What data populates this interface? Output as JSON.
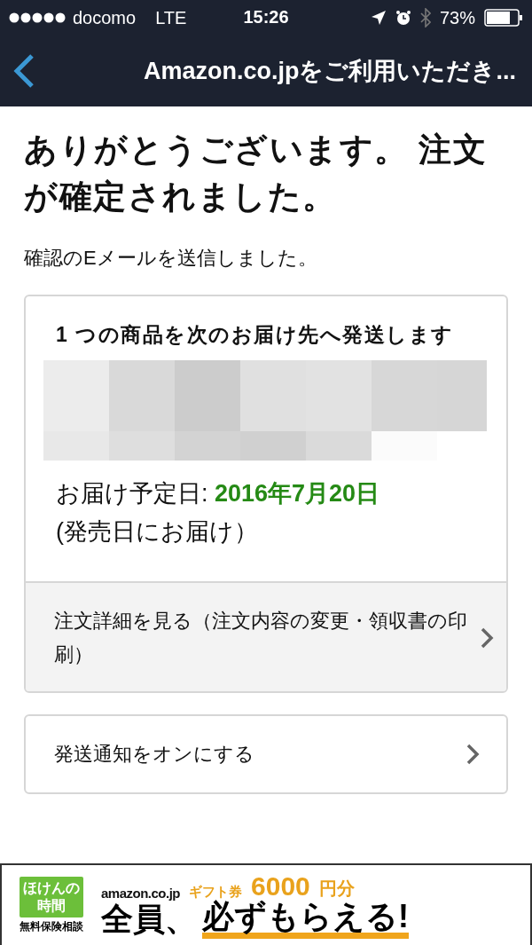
{
  "status_bar": {
    "carrier": "docomo",
    "network": "LTE",
    "time": "15:26",
    "battery": "73%"
  },
  "nav": {
    "title": "Amazon.co.jpをご利用いただき..."
  },
  "heading": "ありがとうございます。 注文が確定されました。",
  "message": "確認のEメールを送信しました。",
  "shipment": {
    "title": "1 つの商品を次のお届け先へ発送します",
    "delivery_label": "お届け予定日: ",
    "delivery_date": "2016年7月20日",
    "note": "(発売日にお届け）",
    "link": "注文詳細を見る（注文内容の変更・領収書の印刷）"
  },
  "actions": [
    {
      "label": "発送通知をオンにする"
    }
  ],
  "ad": {
    "logo_lines": [
      "ほけんの",
      "時間"
    ],
    "logo_caption": "無料保険相談",
    "brand": "amazon.co.jp",
    "gift": "ギフト券",
    "amount": "6000",
    "unit": "円分",
    "headline_1": "全員、",
    "headline_2": "必ずもらえる!"
  }
}
